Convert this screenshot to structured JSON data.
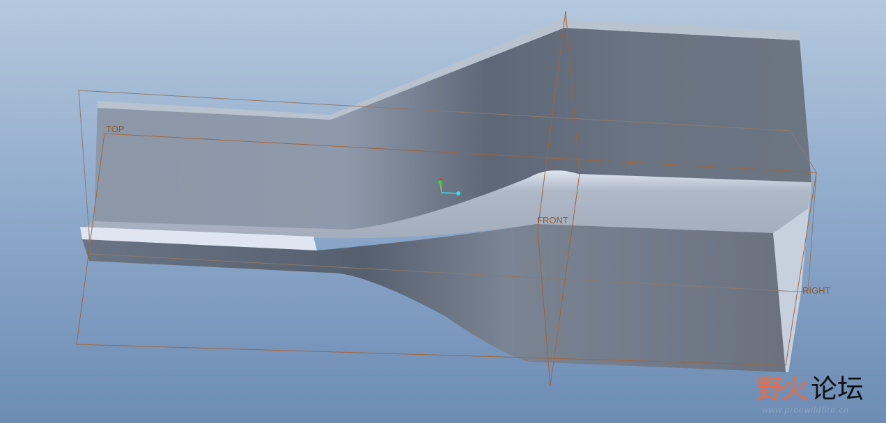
{
  "datums": {
    "top": "TOP",
    "front": "FRONT",
    "right": "RIGHT"
  },
  "watermark": {
    "name_part1": "野火",
    "name_part2": "论坛",
    "url": "www.proewildfire.cn"
  },
  "colors": {
    "datum": "#a0643a",
    "accent_orange": "#ee6a3c"
  }
}
